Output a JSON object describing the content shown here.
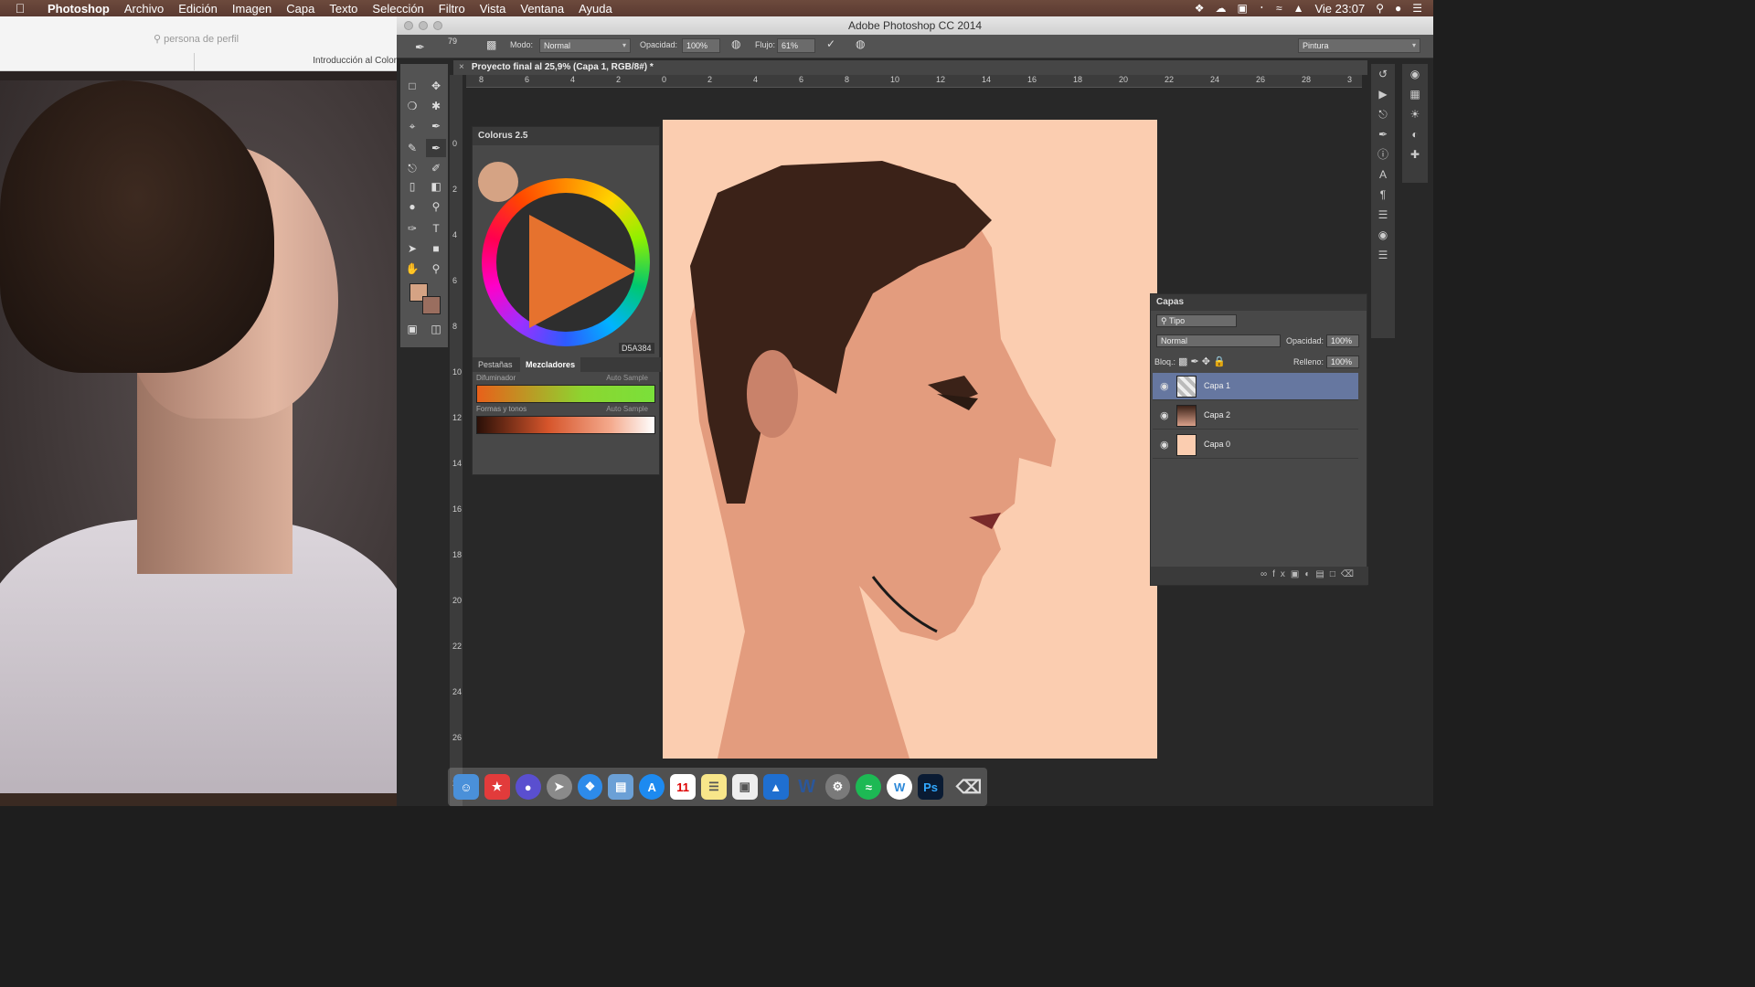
{
  "menubar": {
    "app": "Photoshop",
    "items": [
      "Archivo",
      "Edición",
      "Imagen",
      "Capa",
      "Texto",
      "Selección",
      "Filtro",
      "Vista",
      "Ventana",
      "Ayuda"
    ],
    "clock": "Vie 23:07"
  },
  "browser": {
    "search_placeholder": "persona de perfil",
    "tab_label": "Introducción al Color"
  },
  "photoshop": {
    "window_title": "Adobe Photoshop CC 2014",
    "options": {
      "brush_size": "79",
      "mode_label": "Modo:",
      "mode_value": "Normal",
      "opacity_label": "Opacidad:",
      "opacity_value": "100%",
      "flow_label": "Flujo:",
      "flow_value": "61%",
      "workspace": "Pintura"
    },
    "doc_tab": "Proyecto final al 25,9% (Capa 1, RGB/8#) *",
    "ruler_h": [
      "8",
      "6",
      "4",
      "2",
      "0",
      "2",
      "4",
      "6",
      "8",
      "10",
      "12",
      "14",
      "16",
      "18",
      "20",
      "22",
      "24",
      "26",
      "28",
      "3"
    ],
    "ruler_v": [
      "0",
      "2",
      "4",
      "6",
      "8",
      "10",
      "12",
      "14",
      "16",
      "18",
      "20",
      "22",
      "24",
      "26",
      "2"
    ]
  },
  "coolorus": {
    "title": "Colorus 2.5",
    "hex": "D5A384",
    "tabs": [
      "Pestañas",
      "Mezcladores"
    ],
    "mixer1_label": "Difuminador",
    "mixer2_label": "Formas y tonos",
    "auto_sample": "Auto Sample"
  },
  "layers_panel": {
    "title": "Capas",
    "filter": "Tipo",
    "blend_mode": "Normal",
    "opacity_label": "Opacidad:",
    "opacity_value": "100%",
    "lock_label": "Bloq.:",
    "fill_label": "Relleno:",
    "fill_value": "100%",
    "layers": [
      {
        "name": "Capa 1",
        "selected": true
      },
      {
        "name": "Capa 2",
        "selected": false
      },
      {
        "name": "Capa 0",
        "selected": false
      }
    ]
  },
  "dock": {
    "apps": [
      "finder-icon",
      "bookmarks-icon",
      "siri-icon",
      "launchpad-icon",
      "safari-icon",
      "preview-icon",
      "appstore-icon",
      "calendar-icon",
      "notes-icon",
      "photos-icon",
      "keynote-icon",
      "word-icon",
      "system-prefs-icon",
      "spotify-icon",
      "wunderlist-icon",
      "photoshop-icon",
      "trash-icon"
    ],
    "calendar_day": "11",
    "ps_label": "Ps",
    "word_label": "W"
  },
  "colors": {
    "foreground": "#D5A384",
    "background": "#9A6E5F",
    "canvas": "#FBCDB0",
    "selected_layer": "#6677A0"
  }
}
